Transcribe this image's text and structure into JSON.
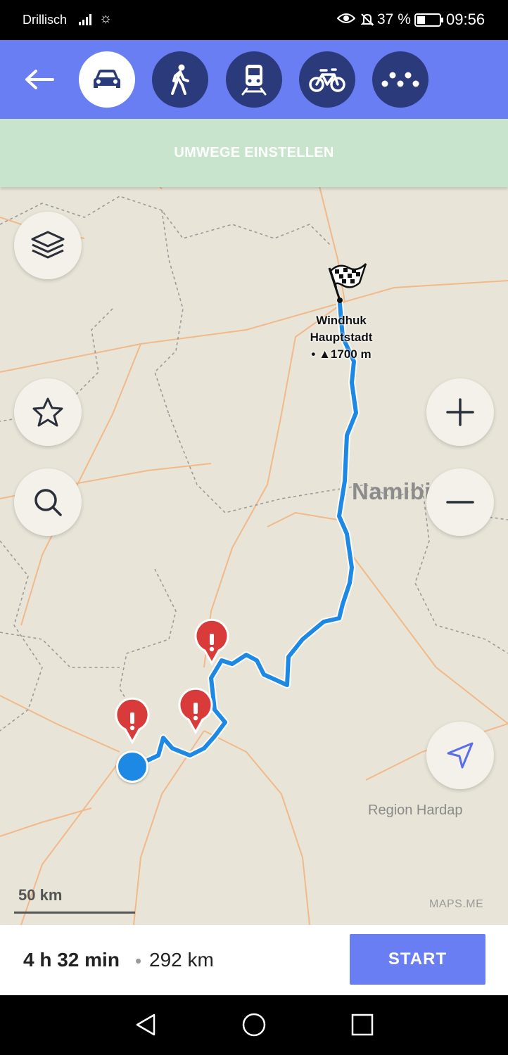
{
  "status_bar": {
    "carrier": "Drillisch",
    "battery_percent": "37 %",
    "battery_level": 0.37,
    "time": "09:56",
    "icons": [
      "signal-icon",
      "brightness-icon",
      "eye-icon",
      "mute-bell-icon",
      "battery-icon"
    ]
  },
  "topbar": {
    "back_icon": "arrow-left-icon",
    "modes": [
      {
        "name": "car",
        "icon": "car-icon",
        "active": true
      },
      {
        "name": "walk",
        "icon": "pedestrian-icon",
        "active": false
      },
      {
        "name": "transit",
        "icon": "train-icon",
        "active": false
      },
      {
        "name": "bicycle",
        "icon": "bicycle-icon",
        "active": false
      },
      {
        "name": "taxi",
        "icon": "taxi-icon",
        "active": false
      }
    ],
    "colors": {
      "bar": "#6a7ef3",
      "inactive": "#2b3a7a",
      "active": "#ffffff"
    }
  },
  "map": {
    "detour_label": "UMWEGE EINSTELLEN",
    "city": {
      "name": "Windhuk",
      "subtitle": "Hauptstadt",
      "elevation": "• ▲1700 m"
    },
    "country_label": "Namibia",
    "region_label": "Region Hardap",
    "attribution": "MAPS.ME",
    "scale_label": "50 km",
    "route_color": "#1e88e5",
    "warning_color": "#d93a3a",
    "warnings": 3
  },
  "route": {
    "duration": "4 h 32 min",
    "separator": "•",
    "distance": "292 km",
    "start_label": "START"
  },
  "navbar": {
    "icons": [
      "back-triangle-icon",
      "home-circle-icon",
      "recents-square-icon"
    ]
  }
}
